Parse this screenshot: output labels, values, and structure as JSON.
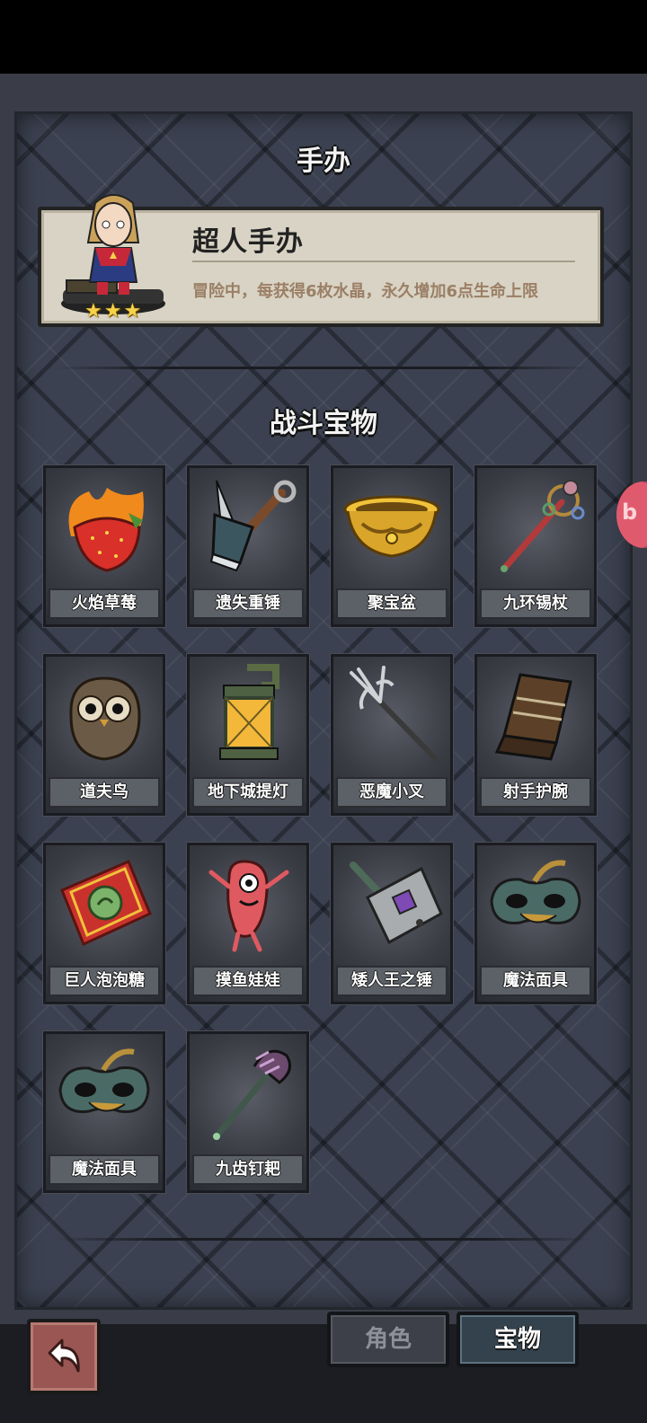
{
  "figure_section": {
    "title": "手办",
    "figure": {
      "name": "超人手办",
      "description": "冒险中，每获得6枚水晶，永久增加6点生命上限",
      "stars": 3
    }
  },
  "treasure_section": {
    "title": "战斗宝物",
    "items": [
      {
        "label": "火焰草莓",
        "icon": "flame-strawberry-icon"
      },
      {
        "label": "遗失重锤",
        "icon": "lost-hammer-icon"
      },
      {
        "label": "聚宝盆",
        "icon": "treasure-bowl-icon"
      },
      {
        "label": "九环锡杖",
        "icon": "nine-ring-staff-icon"
      },
      {
        "label": "道夫鸟",
        "icon": "owl-icon"
      },
      {
        "label": "地下城提灯",
        "icon": "lantern-icon"
      },
      {
        "label": "恶魔小叉",
        "icon": "trident-icon"
      },
      {
        "label": "射手护腕",
        "icon": "bracer-icon"
      },
      {
        "label": "巨人泡泡糖",
        "icon": "bubble-gum-icon"
      },
      {
        "label": "摸鱼娃娃",
        "icon": "fish-doll-icon"
      },
      {
        "label": "矮人王之锤",
        "icon": "dwarf-hammer-icon"
      },
      {
        "label": "魔法面具",
        "icon": "magic-mask-icon"
      },
      {
        "label": "魔法面具",
        "icon": "magic-mask-icon"
      },
      {
        "label": "九齿钉耙",
        "icon": "nine-tooth-rake-icon"
      }
    ]
  },
  "nav": {
    "tabs": [
      {
        "label": "角色",
        "active": false
      },
      {
        "label": "宝物",
        "active": true
      }
    ]
  },
  "colors": {
    "panel": "#3b4150",
    "card": "#d8d3c4",
    "star": "#f6d24a",
    "back_button": "#9a5652"
  }
}
